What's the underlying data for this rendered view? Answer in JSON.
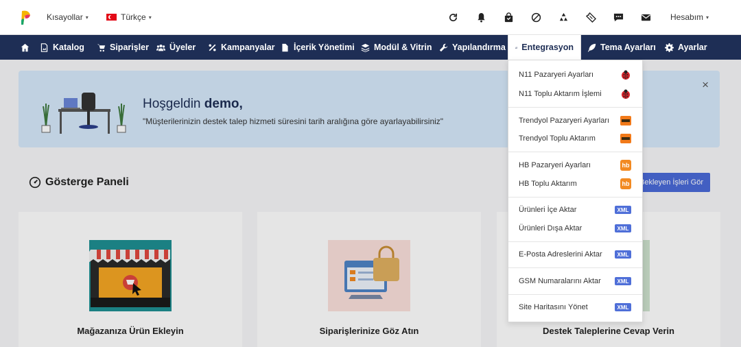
{
  "topbar": {
    "shortcuts_label": "Kısayollar",
    "language_label": "Türkçe",
    "account_label": "Hesabım",
    "icons": [
      "refresh-icon",
      "bell-icon",
      "shopping-bag-icon",
      "ban-icon",
      "recycle-icon",
      "ticket-icon",
      "chat-icon",
      "mail-icon"
    ]
  },
  "nav": {
    "items": [
      {
        "label": ""
      },
      {
        "label": "Katalog"
      },
      {
        "label": "Siparişler"
      },
      {
        "label": "Üyeler"
      },
      {
        "label": "Kampanyalar"
      },
      {
        "label": "İçerik Yönetimi"
      },
      {
        "label": "Modül & Vitrin"
      },
      {
        "label": "Yapılandırma"
      },
      {
        "label": "Entegrasyon"
      },
      {
        "label": "Tema Ayarları"
      },
      {
        "label": "Ayarlar"
      }
    ]
  },
  "welcome": {
    "greeting": "Hoşgeldin ",
    "user": "demo,",
    "message": "\"Müşterilerinizin destek talep hizmeti süresini tarih aralığına göre ayarlayabilirsiniz\"",
    "close": "×"
  },
  "dashboard": {
    "title": "Gösterge Paneli",
    "button_label": "Bekleyen İşleri Gör",
    "cards": [
      {
        "title": "Mağazanıza Ürün Ekleyin"
      },
      {
        "title": "Siparişlerinize Göz Atın"
      },
      {
        "title": "Destek Taleplerine Cevap Verin"
      }
    ]
  },
  "dropdown": {
    "items": [
      {
        "label": "N11 Pazaryeri Ayarları",
        "badge": "n11",
        "badge_text": ""
      },
      {
        "label": "N11 Toplu Aktarım İşlemi",
        "badge": "n11",
        "badge_text": ""
      },
      {
        "label": "Trendyol Pazaryeri Ayarları",
        "badge": "ty",
        "badge_text": ""
      },
      {
        "label": "Trendyol Toplu Aktarım",
        "badge": "ty",
        "badge_text": ""
      },
      {
        "label": "HB Pazaryeri Ayarları",
        "badge": "hb",
        "badge_text": "hb"
      },
      {
        "label": "HB Toplu Aktarım",
        "badge": "hb",
        "badge_text": "hb"
      },
      {
        "label": "Ürünleri İçe Aktar",
        "badge": "xml",
        "badge_text": "XML"
      },
      {
        "label": "Ürünleri Dışa Aktar",
        "badge": "xml",
        "badge_text": "XML"
      },
      {
        "label": "E-Posta Adreslerini Aktar",
        "badge": "xml",
        "badge_text": "XML"
      },
      {
        "label": "GSM Numaralarını Aktar",
        "badge": "xml",
        "badge_text": "XML"
      },
      {
        "label": "Site Haritasını Yönet",
        "badge": "xml",
        "badge_text": "XML"
      }
    ]
  },
  "colors": {
    "nav_bg": "#1e2e55",
    "accent": "#4f6fd8",
    "welcome_bg": "#d6e9fb"
  }
}
